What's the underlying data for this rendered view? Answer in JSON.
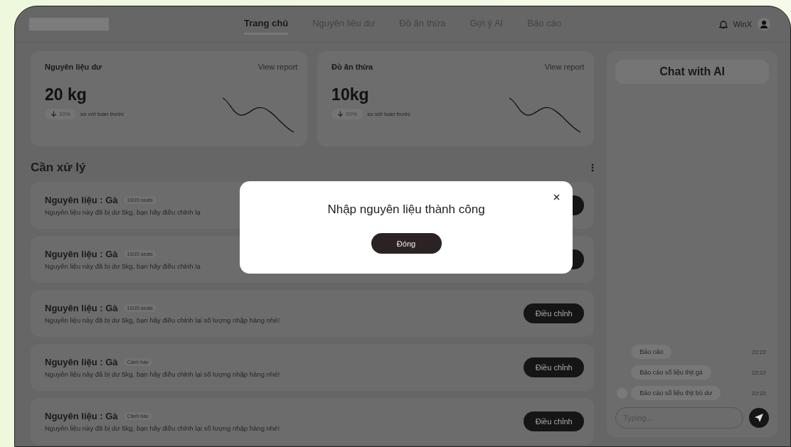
{
  "nav": {
    "tabs": [
      {
        "label": "Trang chủ",
        "selected": true
      },
      {
        "label": "Nguyên liệu dư",
        "selected": false
      },
      {
        "label": "Đồ ăn thừa",
        "selected": false
      },
      {
        "label": "Gợi ý AI",
        "selected": false
      },
      {
        "label": "Báo cáo",
        "selected": false
      }
    ],
    "user": "WinX"
  },
  "stats": [
    {
      "title": "Nguyên liệu dư",
      "link": "View report",
      "value": "20 kg",
      "delta": "10%",
      "compare": "so với tuần trước"
    },
    {
      "title": "Đồ ăn thừa",
      "link": "View report",
      "value": "10kg",
      "delta": "20%",
      "compare": "so với tuần trước"
    }
  ],
  "tasks": {
    "title": "Cần xử lý",
    "items": [
      {
        "name": "Nguyên liệu : Gà",
        "tag": "10/20 seats",
        "description": "Nguyên liệu này đã bị dư 5kg, bạn hãy điều chỉnh lạ"
      },
      {
        "name": "Nguyên liệu : Gà",
        "tag": "10/20 seats",
        "description": "Nguyên liệu này đã bị dư 5kg, bạn hãy điều chỉnh lạ"
      },
      {
        "name": "Nguyên liệu : Gà",
        "tag": "10/20 seats",
        "description": "Nguyên liệu này đã bị dư 5kg, bạn hãy điều chỉnh lại số lượng nhập hàng nhé!",
        "action": "Điều chỉnh"
      },
      {
        "name": "Nguyên liệu : Gà",
        "tag": "Cảnh báo",
        "description": "Nguyên liệu này đã bị dư 5kg, bạn hãy điều chỉnh lại số lượng nhập hàng nhé!",
        "action": "Điều chỉnh"
      },
      {
        "name": "Nguyên liệu : Gà",
        "tag": "Cảnh báo",
        "description": "Nguyên liệu này đã bị dư 5kg, bạn hãy điều chỉnh lại số lượng nhập hàng nhé!",
        "action": "Điều chỉnh"
      }
    ]
  },
  "chat": {
    "title": "Chat with AI",
    "messages": [
      {
        "text": "Báo cáo",
        "time": "22:22"
      },
      {
        "text": "Báo cáo số liệu thịt gà",
        "time": "22:22"
      },
      {
        "text": "Báo cáo số liệu thịt bò dư",
        "time": "22:22"
      }
    ],
    "placeholder": "Typing..."
  },
  "modal": {
    "title": "Nhập nguyên liệu thành công",
    "button": "Đóng"
  }
}
